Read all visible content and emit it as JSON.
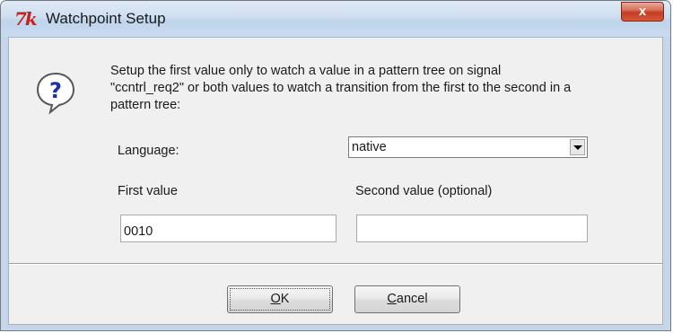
{
  "window": {
    "title": "Watchpoint Setup",
    "app_icon_text": "7k",
    "close_glyph": "x"
  },
  "dialog": {
    "icon": "question-icon",
    "icon_glyph": "?",
    "message_lines": [
      "Setup the first value only to watch a value in a pattern tree on signal",
      "\"ccntrl_req2\" or both values to watch a transition from the first to the second in a",
      "pattern tree:"
    ],
    "language_label": "Language:",
    "language_value": "native",
    "first_value_label": "First value",
    "second_value_label": "Second value (optional)",
    "first_value": "0010",
    "second_value": ""
  },
  "buttons": {
    "ok_mnemonic": "O",
    "ok_rest": "K",
    "cancel_mnemonic": "C",
    "cancel_rest": "ancel"
  },
  "colors": {
    "titlebar": "#cfdff0",
    "close": "#c43c20",
    "dialog_bg": "#f0f0f0",
    "icon_blue": "#1a2fb0"
  }
}
